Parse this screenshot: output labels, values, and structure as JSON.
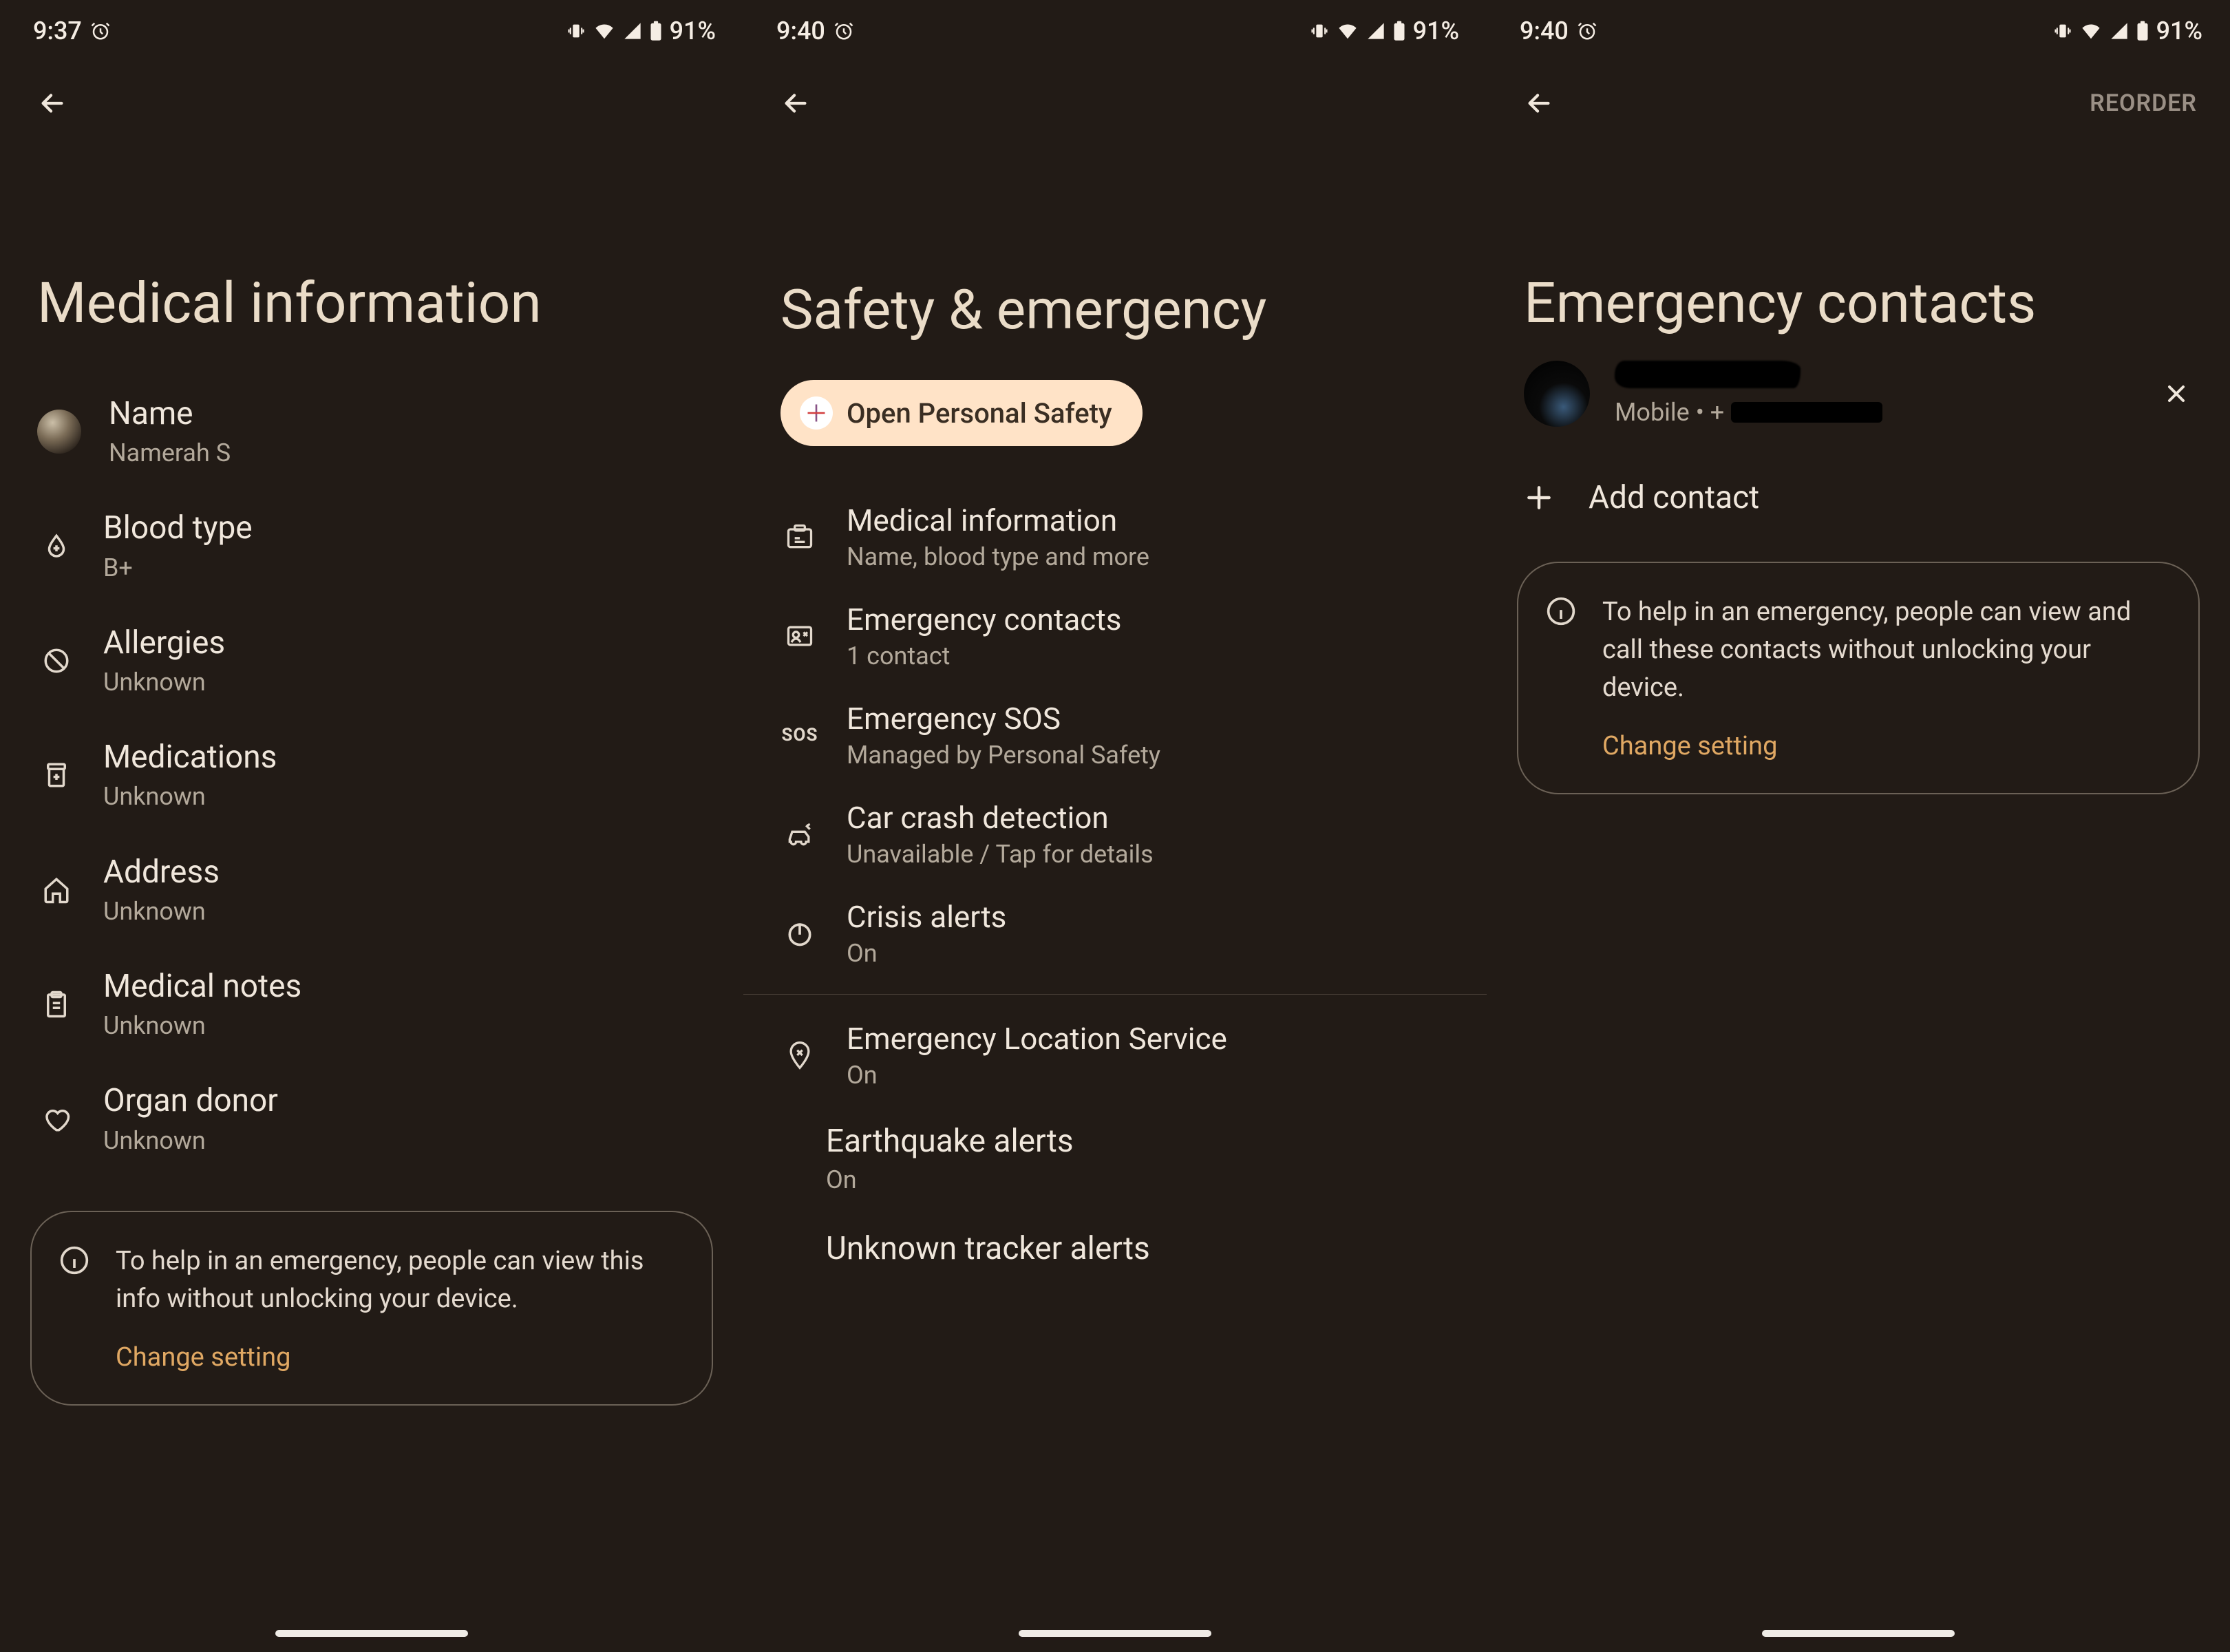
{
  "status": {
    "time1": "9:37",
    "time2": "9:40",
    "time3": "9:40",
    "battery": "91%"
  },
  "screen1": {
    "title": "Medical information",
    "items": [
      {
        "title": "Name",
        "sub": "Namerah S"
      },
      {
        "title": "Blood type",
        "sub": "B+"
      },
      {
        "title": "Allergies",
        "sub": "Unknown"
      },
      {
        "title": "Medications",
        "sub": "Unknown"
      },
      {
        "title": "Address",
        "sub": "Unknown"
      },
      {
        "title": "Medical notes",
        "sub": "Unknown"
      },
      {
        "title": "Organ donor",
        "sub": "Unknown"
      }
    ],
    "card": {
      "text": "To help in an emergency, people can view this info without unlocking your device.",
      "link": "Change setting"
    }
  },
  "screen2": {
    "title": "Safety & emergency",
    "pill": "Open Personal Safety",
    "items": [
      {
        "title": "Medical information",
        "sub": "Name, blood type and more"
      },
      {
        "title": "Emergency contacts",
        "sub": "1 contact"
      },
      {
        "title": "Emergency SOS",
        "sub": "Managed by Personal Safety"
      },
      {
        "title": "Car crash detection",
        "sub": "Unavailable / Tap for details"
      },
      {
        "title": "Crisis alerts",
        "sub": "On"
      }
    ],
    "after_divider": [
      {
        "title": "Emergency Location Service",
        "sub": "On"
      }
    ],
    "noicon": [
      {
        "title": "Earthquake alerts",
        "sub": "On"
      },
      {
        "title": "Unknown tracker alerts",
        "sub": ""
      }
    ]
  },
  "screen3": {
    "title": "Emergency contacts",
    "reorder": "REORDER",
    "contact_sub_prefix": "Mobile  •  +",
    "add": "Add contact",
    "card": {
      "text": "To help in an emergency, people can view and call these contacts without unlocking your device.",
      "link": "Change setting"
    }
  }
}
